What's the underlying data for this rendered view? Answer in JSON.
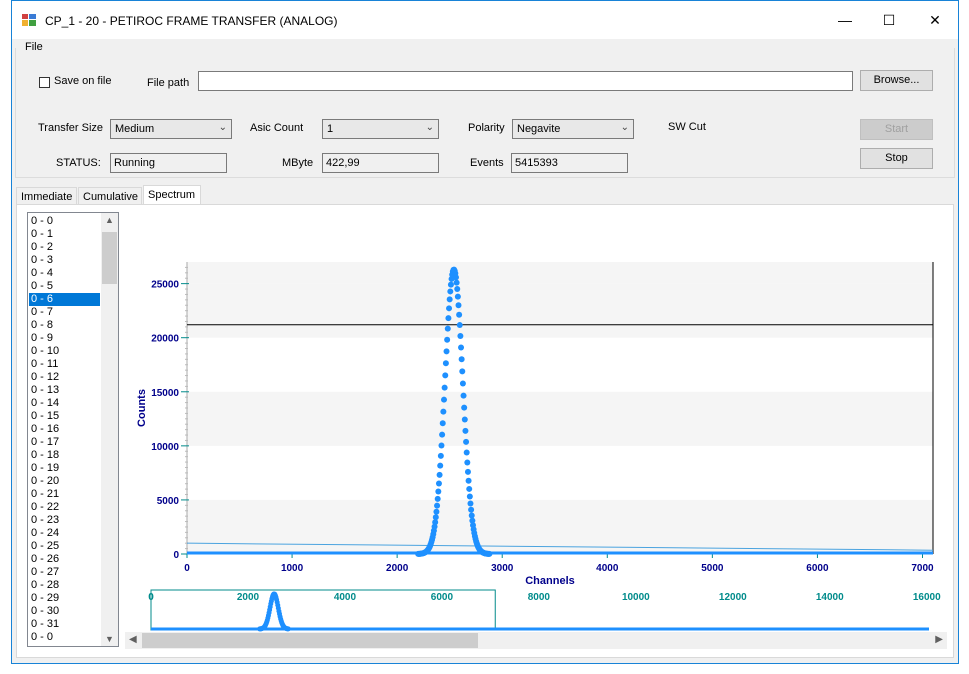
{
  "window": {
    "title": "CP_1 - 20 - PETIROC FRAME TRANSFER (ANALOG)",
    "minimize_glyph": "—",
    "maximize_glyph": "☐",
    "close_glyph": "✕"
  },
  "menu": {
    "file": "File"
  },
  "controls": {
    "save_on_file_label": "Save on file",
    "save_on_file_checked": false,
    "file_path_label": "File path",
    "file_path_value": "",
    "browse_label": "Browse...",
    "transfer_size_label": "Transfer Size",
    "transfer_size_value": "Medium",
    "asic_count_label": "Asic Count",
    "asic_count_value": "1",
    "polarity_label": "Polarity",
    "polarity_value": "Negavite",
    "sw_cut_label": "SW Cut",
    "start_label": "Start",
    "stop_label": "Stop",
    "status_label": "STATUS:",
    "status_value": "Running",
    "mbyte_label": "MByte",
    "mbyte_value": "422,99",
    "events_label": "Events",
    "events_value": "5415393"
  },
  "tabs": [
    "Immediate",
    "Cumulative",
    "Spectrum"
  ],
  "active_tab": "Spectrum",
  "channel_list": {
    "items": [
      "0 - 0",
      "0 - 1",
      "0 - 2",
      "0 - 3",
      "0 - 4",
      "0 - 5",
      "0 - 6",
      "0 - 7",
      "0 - 8",
      "0 - 9",
      "0 - 10",
      "0 - 11",
      "0 - 12",
      "0 - 13",
      "0 - 14",
      "0 - 15",
      "0 - 16",
      "0 - 17",
      "0 - 18",
      "0 - 19",
      "0 - 20",
      "0 - 21",
      "0 - 22",
      "0 - 23",
      "0 - 24",
      "0 - 25",
      "0 - 26",
      "0 - 27",
      "0 - 28",
      "0 - 29",
      "0 - 30",
      "0 - 31",
      "0 - 0"
    ],
    "selected_index": 6
  },
  "chart_data": {
    "type": "scatter",
    "xlabel": "Channels",
    "ylabel": "Counts",
    "xlim": [
      0,
      7100
    ],
    "ylim": [
      0,
      27000
    ],
    "x_ticks": [
      0,
      1000,
      2000,
      3000,
      4000,
      5000,
      6000,
      7000
    ],
    "y_ticks": [
      0,
      5000,
      10000,
      15000,
      20000,
      25000
    ],
    "threshold_line_y": 21200,
    "peak": {
      "center": 2540,
      "height": 26300,
      "sigma": 85
    },
    "baseline": {
      "start": 1000,
      "end": 350
    },
    "series_color": "#1e90ff",
    "axis_label_color": "#00008b",
    "overview": {
      "xlim": [
        0,
        16500
      ],
      "x_ticks": [
        0,
        2000,
        4000,
        6000,
        8000,
        10000,
        12000,
        14000,
        16000
      ],
      "tick_color": "#008b8b",
      "window_range": [
        0,
        7100
      ]
    }
  }
}
